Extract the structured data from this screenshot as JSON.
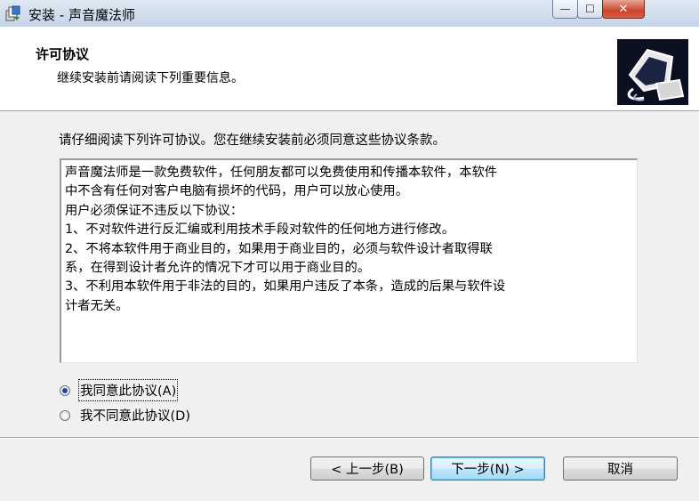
{
  "window": {
    "title": "安装 - 声音魔法师",
    "minimize_glyph": "—",
    "maximize_glyph": "☐",
    "close_glyph": "✕",
    "app_icon": "installer-icon"
  },
  "header": {
    "title": "许可协议",
    "subtitle": "继续安装前请阅读下列重要信息。",
    "image": "computer-installer-graphic"
  },
  "body": {
    "intro": "请仔细阅读下列许可协议。您在继续安装前必须同意这些协议条款。",
    "license_lines": [
      "声音魔法师是一款免费软件，任何朋友都可以免费使用和传播本软件，本软件",
      "中不含有任何对客户电脑有损坏的代码，用户可以放心使用。",
      "用户必须保证不违反以下协议：",
      "1、不对软件进行反汇编或利用技术手段对软件的任何地方进行修改。",
      "2、不将本软件用于商业目的，如果用于商业目的，必须与软件设计者取得联",
      "系，在得到设计者允许的情况下才可以用于商业目的。",
      "3、不利用本软件用于非法的目的，如果用户违反了本条，造成的后果与软件设",
      "计者无关。"
    ],
    "accept_label": "我同意此协议(A)",
    "decline_label": "我不同意此协议(D)",
    "selected": "accept"
  },
  "buttons": {
    "back": "< 上一步(B)",
    "next": "下一步(N) >",
    "cancel": "取消"
  },
  "colors": {
    "header_bg": "#ffffff",
    "dialog_bg": "#f0f0f0",
    "radio_dot": "#1b4aa5",
    "close_button": "#c9462c"
  }
}
